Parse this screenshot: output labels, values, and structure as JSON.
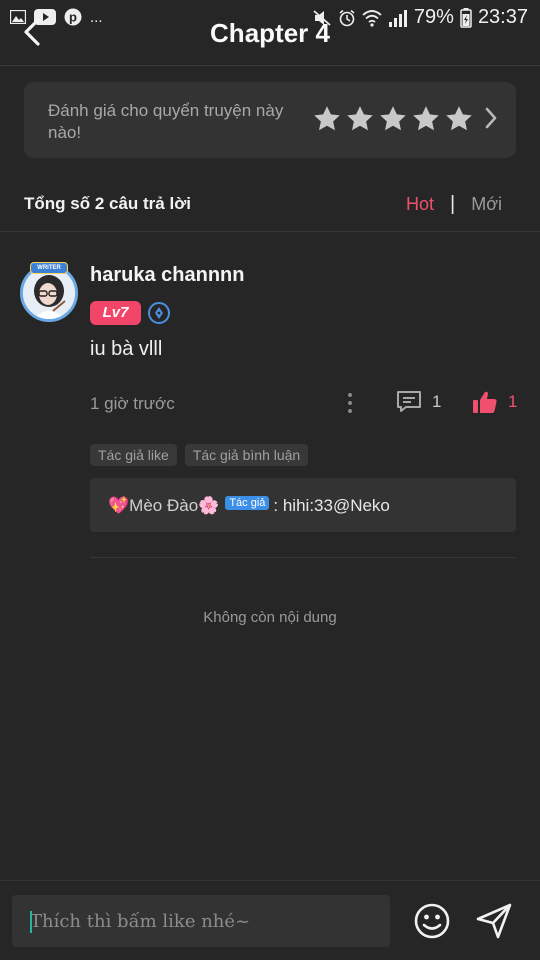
{
  "status_bar": {
    "more": "...",
    "battery": "79%",
    "time": "23:37"
  },
  "header": {
    "title": "Chapter 4"
  },
  "rating": {
    "prompt": "Đánh giá cho quyển truyện này nào!",
    "stars": 5
  },
  "comments_bar": {
    "count_text": "Tổng số 2 câu trả lời",
    "sort_hot": "Hot",
    "sort_separator": "|",
    "sort_new": "Mới",
    "active_sort": "Hot"
  },
  "comment": {
    "username": "haruka channnn",
    "level": "Lv7",
    "avatar_badge": "WRITER",
    "text": "iu bà vlll",
    "time": "1 giờ trước",
    "reply_count": "1",
    "like_count": "1",
    "tags": [
      "Tác giả like",
      "Tác giả bình luận"
    ],
    "reply": {
      "author": "💖Mèo Đào🌸",
      "author_tag": "Tác giả",
      "text": ": hihi:33@Neko"
    }
  },
  "footer": {
    "no_more": "Không còn nội dung"
  },
  "input_bar": {
    "placeholder": "Thích thì bấm like nhé~",
    "value": ""
  },
  "colors": {
    "background": "#262626",
    "card": "#333333",
    "accent": "#f0506e",
    "author_blue": "#3c8fe6"
  },
  "icons": {
    "back": "chevron-left-icon",
    "rating_next": "chevron-right-icon",
    "more": "more-vertical-icon",
    "reply": "comment-icon",
    "like": "thumbs-up-icon",
    "emoji": "smiley-icon",
    "send": "send-icon"
  }
}
